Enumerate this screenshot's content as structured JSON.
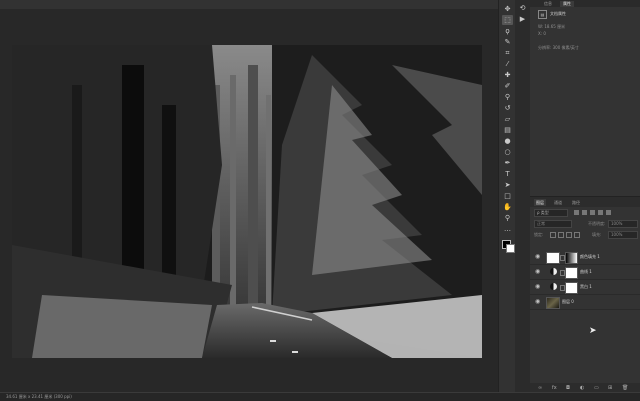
{
  "status": {
    "doc_info": "34.61 厘米 x 23.41 厘米 (300 ppi)",
    "right_a": "",
    "right_b": ""
  },
  "toolbar": {
    "tools": [
      {
        "name": "move-tool-icon",
        "glyph": "✥"
      },
      {
        "name": "marquee-tool-icon",
        "glyph": "⬚"
      },
      {
        "name": "lasso-tool-icon",
        "glyph": "ϙ"
      },
      {
        "name": "quick-select-tool-icon",
        "glyph": "✎"
      },
      {
        "name": "crop-tool-icon",
        "glyph": "⌗"
      },
      {
        "name": "eyedropper-tool-icon",
        "glyph": "⁄"
      },
      {
        "name": "healing-brush-tool-icon",
        "glyph": "✚"
      },
      {
        "name": "brush-tool-icon",
        "glyph": "✐"
      },
      {
        "name": "clone-stamp-tool-icon",
        "glyph": "⚲"
      },
      {
        "name": "history-brush-tool-icon",
        "glyph": "↺"
      },
      {
        "name": "eraser-tool-icon",
        "glyph": "▱"
      },
      {
        "name": "gradient-tool-icon",
        "glyph": "▤"
      },
      {
        "name": "blur-tool-icon",
        "glyph": "●"
      },
      {
        "name": "dodge-tool-icon",
        "glyph": "○"
      },
      {
        "name": "pen-tool-icon",
        "glyph": "✒"
      },
      {
        "name": "type-tool-icon",
        "glyph": "T"
      },
      {
        "name": "path-select-tool-icon",
        "glyph": "➤"
      },
      {
        "name": "shape-tool-icon",
        "glyph": "□"
      },
      {
        "name": "hand-tool-icon",
        "glyph": "✋"
      },
      {
        "name": "zoom-tool-icon",
        "glyph": "⚲"
      },
      {
        "name": "more-tools-icon",
        "glyph": "…"
      }
    ]
  },
  "dock": {
    "history_icon": "history-icon",
    "info_icon": "info-icon"
  },
  "properties": {
    "tabs": [
      "信息",
      "属性"
    ],
    "title": "文档属性",
    "w_label": "W:  18.65  厘米",
    "x_label": "X:  0",
    "h_label": "H:  0",
    "res_label": "分辨率: 300 像素/英寸"
  },
  "layers": {
    "tabs": [
      "图层",
      "通道",
      "路径"
    ],
    "filter_placeholder": "ρ 类型",
    "blend_mode": "正常",
    "opacity_label": "不透明度:",
    "opacity_value": "100%",
    "lock_label": "锁定:",
    "fill_label": "填充:",
    "fill_value": "100%",
    "items": [
      {
        "name": "颜色填充 1",
        "type": "fill"
      },
      {
        "name": "曲线 1",
        "type": "curves"
      },
      {
        "name": "黑白 1",
        "type": "bw"
      },
      {
        "name": "图层 0",
        "type": "pixel"
      }
    ]
  },
  "colors": {
    "ui_dark": "#282828",
    "panel": "#333333",
    "accent_text": "#d2d2d2"
  }
}
